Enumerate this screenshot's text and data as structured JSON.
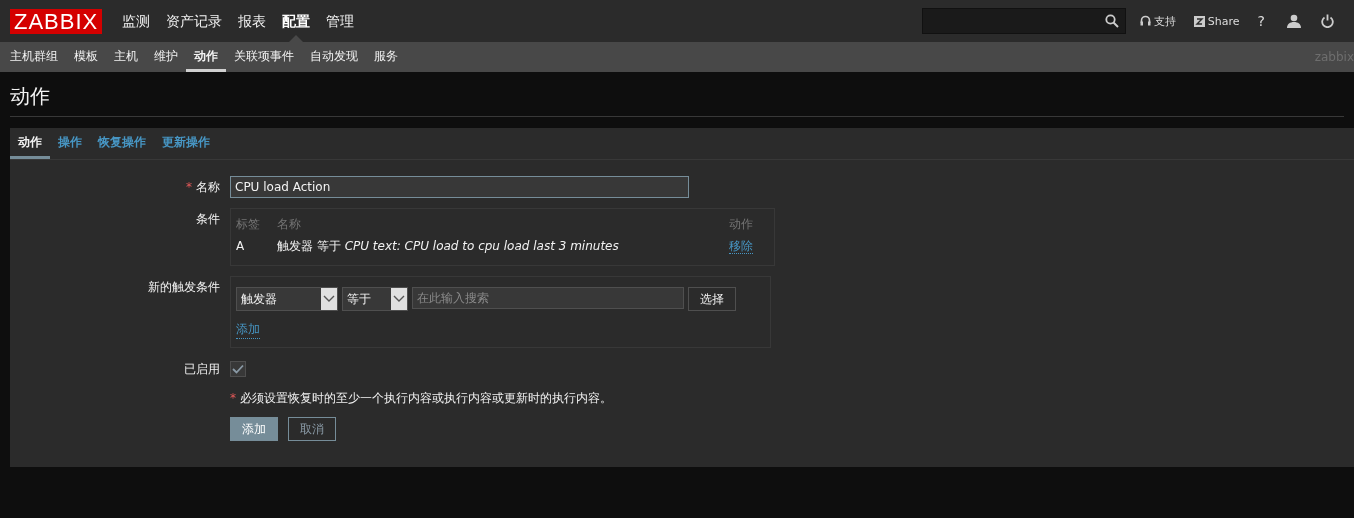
{
  "logo": "ZABBIX",
  "main_menu": [
    {
      "label": "监测",
      "selected": false
    },
    {
      "label": "资产记录",
      "selected": false
    },
    {
      "label": "报表",
      "selected": false
    },
    {
      "label": "配置",
      "selected": true
    },
    {
      "label": "管理",
      "selected": false
    }
  ],
  "header_links": [
    {
      "kind": "support",
      "label": "支持"
    },
    {
      "kind": "share",
      "label": "Share"
    },
    {
      "kind": "help",
      "label": "?"
    },
    {
      "kind": "user"
    },
    {
      "kind": "logout"
    }
  ],
  "sub_menu": [
    {
      "label": "主机群组",
      "selected": false
    },
    {
      "label": "模板",
      "selected": false
    },
    {
      "label": "主机",
      "selected": false
    },
    {
      "label": "维护",
      "selected": false
    },
    {
      "label": "动作",
      "selected": true
    },
    {
      "label": "关联项事件",
      "selected": false
    },
    {
      "label": "自动发现",
      "selected": false
    },
    {
      "label": "服务",
      "selected": false
    }
  ],
  "server_name": "zabbix",
  "page_title": "动作",
  "tabs": [
    {
      "label": "动作",
      "selected": true
    },
    {
      "label": "操作",
      "selected": false
    },
    {
      "label": "恢复操作",
      "selected": false
    },
    {
      "label": "更新操作",
      "selected": false
    }
  ],
  "name_field": {
    "required_mark": "*",
    "label": "名称",
    "value": "CPU load Action"
  },
  "conditions": {
    "label": "条件",
    "columns": [
      "标签",
      "名称",
      "动作"
    ],
    "rows": [
      {
        "label": "A",
        "name": "触发器 等于 *CPU text: CPU load to cpu load last 3 minutes*",
        "action": "移除"
      }
    ]
  },
  "new_condition": {
    "label": "新的触发条件",
    "type": "触发器",
    "operator": "等于",
    "placeholder": "在此输入搜索",
    "select_button": "选择",
    "add_link": "添加"
  },
  "enabled": {
    "label": "已启用",
    "checked": true
  },
  "note": {
    "mark": "*",
    "text": "必须设置恢复时的至少一个执行内容或执行内容或更新时的执行内容。"
  },
  "buttons": [
    {
      "kind": "primary",
      "label": "添加"
    },
    {
      "kind": "secondary",
      "label": "取消"
    }
  ]
}
